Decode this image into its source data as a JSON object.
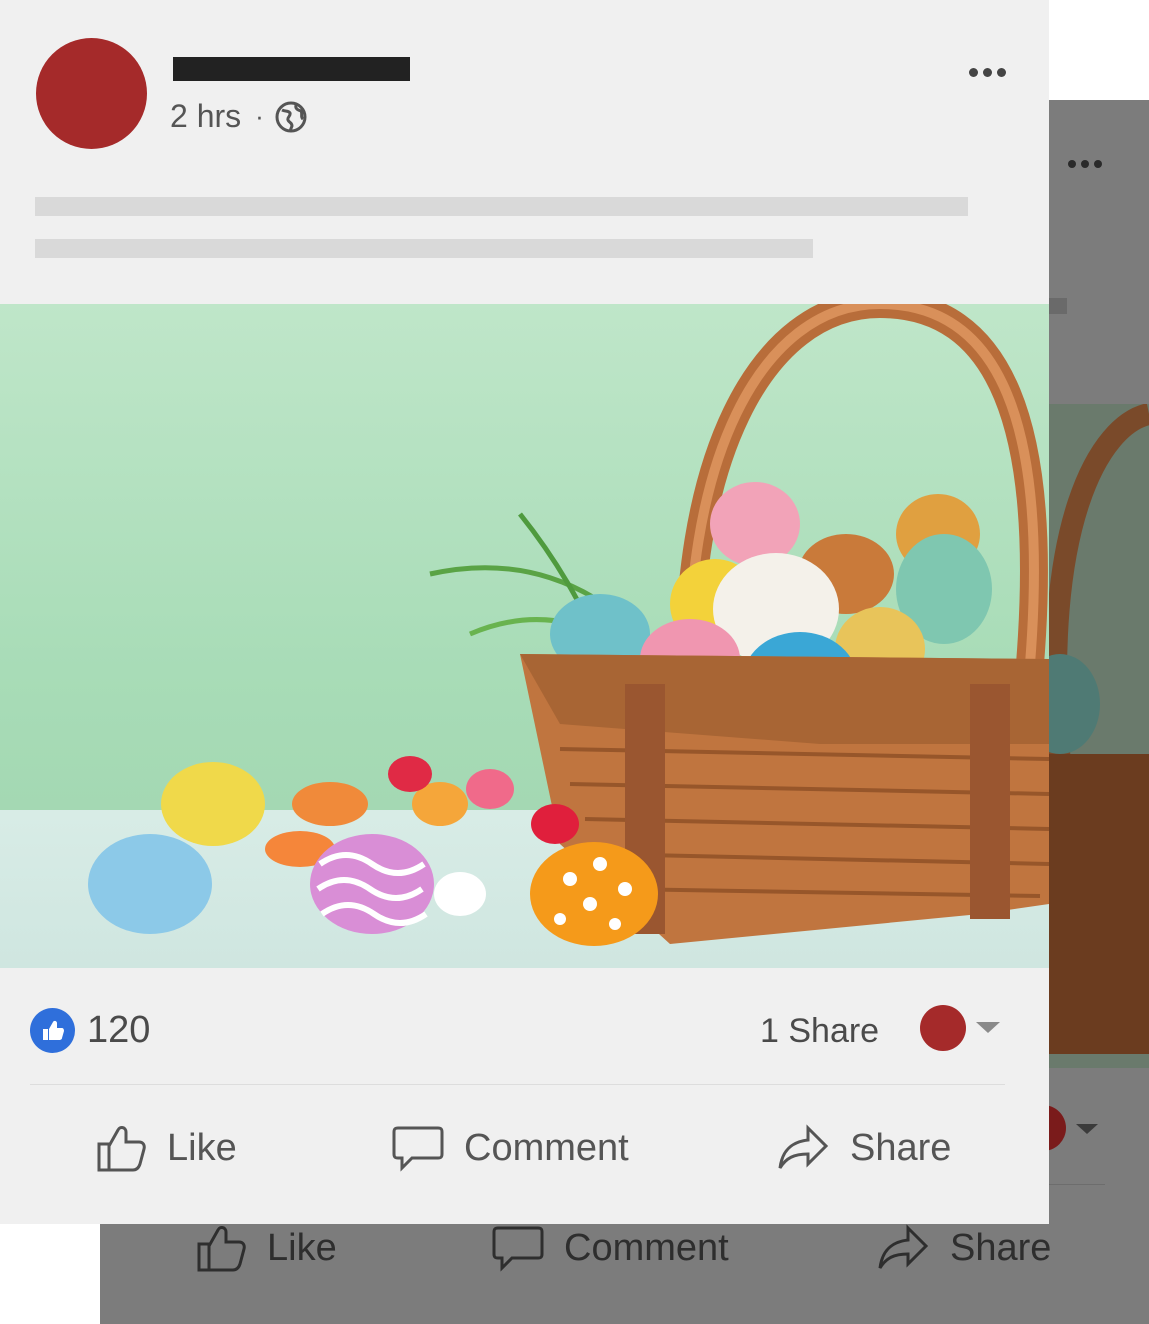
{
  "post": {
    "time": "2 hrs",
    "separator": "·",
    "reactions": {
      "like_count": "120"
    },
    "shares_text": "1 Share"
  },
  "actions": {
    "like": "Like",
    "comment": "Comment",
    "share": "Share"
  },
  "icons": {
    "audience": "globe-icon",
    "menu": "more-options-icon",
    "like": "thumbs-up-icon",
    "comment": "speech-bubble-icon",
    "share": "share-arrow-icon"
  },
  "colors": {
    "avatar": "#a52a2a",
    "like_badge": "#2f6fdb",
    "card_background": "#f0f0f0"
  }
}
